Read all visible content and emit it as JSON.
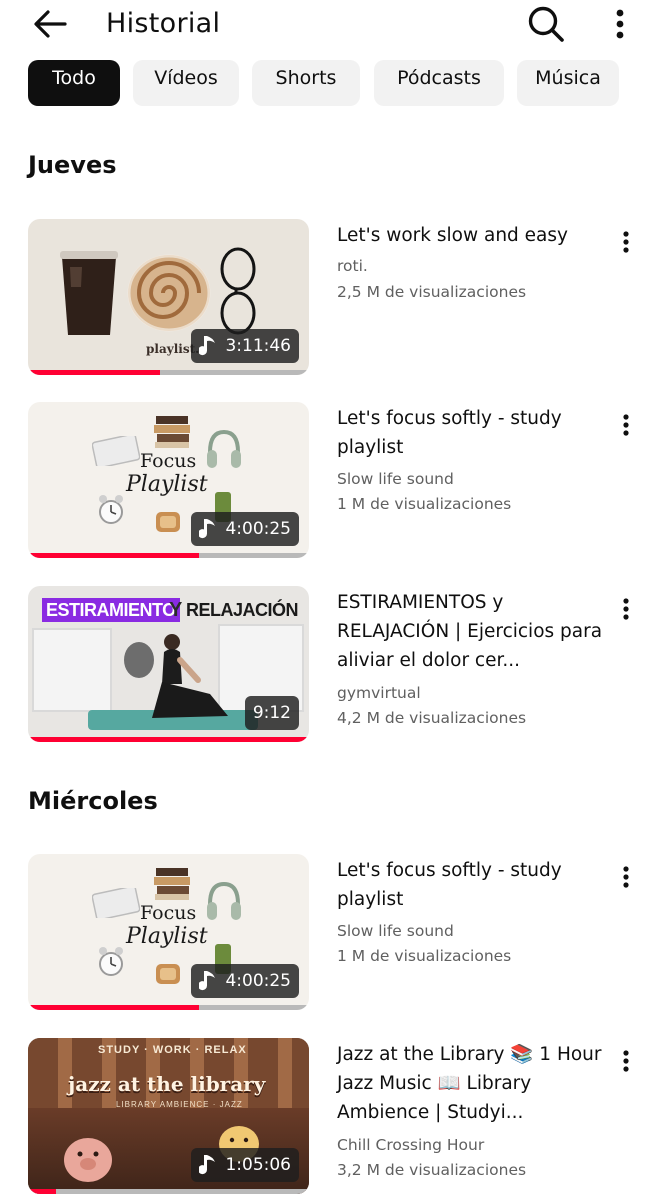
{
  "header": {
    "title": "Historial",
    "back_icon": "arrow-back-icon",
    "search_icon": "search-icon",
    "more_icon": "more-vert-icon"
  },
  "chips": [
    {
      "label": "Todo",
      "active": true
    },
    {
      "label": "Vídeos",
      "active": false
    },
    {
      "label": "Shorts",
      "active": false
    },
    {
      "label": "Pódcasts",
      "active": false
    },
    {
      "label": "Música",
      "active": false
    }
  ],
  "sections": [
    {
      "title": "Jueves",
      "videos": [
        {
          "title": "Let's work slow and easy",
          "channel": "roti.",
          "views": "2,5 M de visualizaciones",
          "duration": "3:11:46",
          "music_icon": true,
          "progress": 0.47,
          "thumb_text": "playlist."
        },
        {
          "title": "Let's focus softly - study playlist",
          "channel": "Slow life sound",
          "views": "1 M de visualizaciones",
          "duration": "4:00:25",
          "music_icon": true,
          "progress": 0.61,
          "thumb_text_1": "Focus",
          "thumb_text_2": "Playlist"
        },
        {
          "title": "ESTIRAMIENTOS y RELAJACIÓN | Ejercicios para aliviar el dolor cer...",
          "channel": "gymvirtual",
          "views": "4,2 M de visualizaciones",
          "duration": "9:12",
          "music_icon": false,
          "progress": 1.0,
          "thumb_text_1": "ESTIRAMIENTO",
          "thumb_text_2": "Y",
          "thumb_text_3": "RELAJACIÓN"
        }
      ]
    },
    {
      "title": "Miércoles",
      "videos": [
        {
          "title": "Let's focus softly - study playlist",
          "channel": "Slow life sound",
          "views": "1 M de visualizaciones",
          "duration": "4:00:25",
          "music_icon": true,
          "progress": 0.61,
          "thumb_text_1": "Focus",
          "thumb_text_2": "Playlist"
        },
        {
          "title": "Jazz at the Library 📚 1 Hour Jazz Music 📖 Library Ambience | Studyi...",
          "channel": "Chill Crossing Hour",
          "views": "3,2 M de visualizaciones",
          "duration": "1:05:06",
          "music_icon": true,
          "progress": 0.1,
          "thumb_text_1": "STUDY · WORK · RELAX",
          "thumb_text_2": "jazz at the library",
          "thumb_text_3": "LIBRARY AMBIENCE · JAZZ"
        }
      ]
    }
  ],
  "colors": {
    "progress": "#ff0033",
    "chip_active_bg": "#0f0f0f",
    "chip_bg": "#f2f2f2",
    "secondary_text": "#606060",
    "purple_label": "#8a2be2"
  }
}
